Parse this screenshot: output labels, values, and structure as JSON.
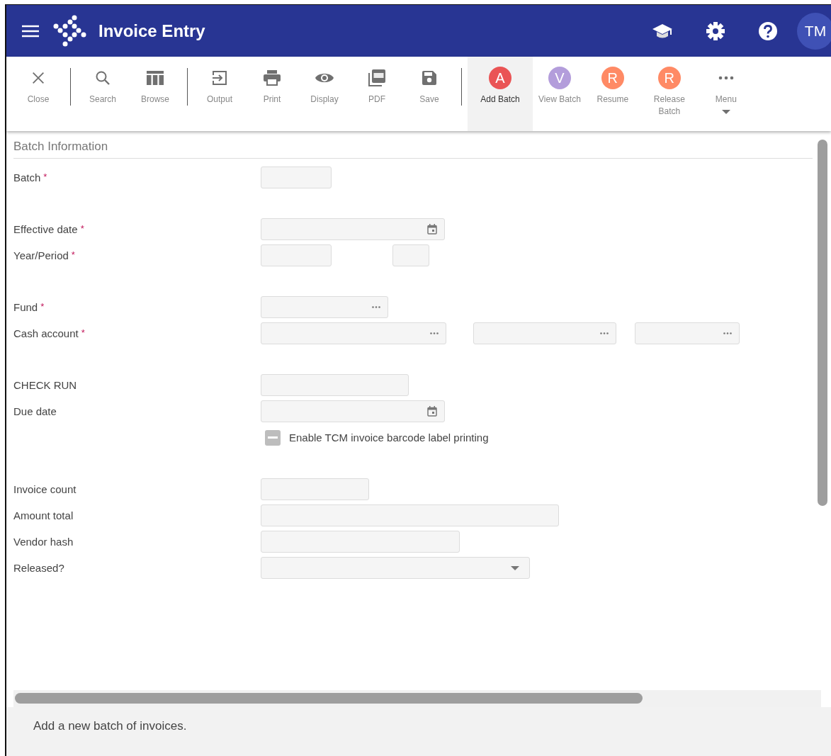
{
  "header": {
    "title": "Invoice Entry",
    "avatar": "TM"
  },
  "toolbar": [
    [
      {
        "kind": "close",
        "label": "Close",
        "selected": false
      }
    ],
    [
      {
        "kind": "search",
        "label": "Search",
        "selected": false
      },
      {
        "kind": "browse",
        "label": "Browse",
        "selected": false
      }
    ],
    [
      {
        "kind": "output",
        "label": "Output",
        "selected": false
      },
      {
        "kind": "print",
        "label": "Print",
        "selected": false
      },
      {
        "kind": "display",
        "label": "Display",
        "selected": false
      },
      {
        "kind": "pdf",
        "label": "PDF",
        "selected": false
      },
      {
        "kind": "save",
        "label": "Save",
        "selected": false
      }
    ],
    [
      {
        "kind": "letter",
        "letter": "A",
        "color": "#ea5455",
        "label": "Add Batch",
        "selected": true
      },
      {
        "kind": "letter",
        "letter": "V",
        "color": "#b39ddb",
        "label": "View Batch",
        "selected": false
      },
      {
        "kind": "letter",
        "letter": "R",
        "color": "#ff8a65",
        "label": "Resume",
        "selected": false
      },
      {
        "kind": "letter",
        "letter": "R",
        "color": "#ff8a65",
        "label": "Release Batch",
        "selected": false
      },
      {
        "kind": "more",
        "label": "Menu",
        "selected": false
      }
    ]
  ],
  "form": {
    "title": "Batch Information",
    "groups": [
      [
        {
          "kind": "field",
          "label": "Batch",
          "mark": "*",
          "inputs": [
            {
              "kind": "text"
            }
          ]
        }
      ],
      [
        {
          "kind": "field",
          "label": "Effective date",
          "mark": "*",
          "inputs": [
            {
              "kind": "date"
            }
          ]
        },
        {
          "kind": "field",
          "label": "Year/Period",
          "mark": "*",
          "inputs": [
            {
              "kind": "text"
            },
            {
              "kind": "text"
            }
          ]
        }
      ],
      [
        {
          "kind": "field",
          "label": "Fund",
          "mark": "*",
          "inputs": [
            {
              "kind": "lookup"
            }
          ]
        },
        {
          "kind": "field",
          "label": "Cash account",
          "mark": "*",
          "inputs": [
            {
              "kind": "lookup"
            },
            {
              "kind": "lookup"
            },
            {
              "kind": "lookup"
            }
          ]
        }
      ],
      [
        {
          "kind": "field",
          "label": "CHECK RUN",
          "inputs": [
            {
              "kind": "text"
            }
          ]
        },
        {
          "kind": "field",
          "label": "Due date",
          "inputs": [
            {
              "kind": "date"
            }
          ]
        },
        {
          "kind": "checkbox",
          "label": "Enable TCM invoice barcode label printing",
          "indeterminate": true
        }
      ],
      [
        {
          "kind": "field",
          "label": "Invoice count",
          "inputs": [
            {
              "kind": "text"
            }
          ]
        },
        {
          "kind": "field",
          "label": "Amount total",
          "inputs": [
            {
              "kind": "text"
            }
          ]
        },
        {
          "kind": "field",
          "label": "Vendor hash",
          "inputs": [
            {
              "kind": "text"
            }
          ]
        },
        {
          "kind": "field",
          "label": "Released?",
          "inputs": [
            {
              "kind": "select"
            }
          ]
        }
      ]
    ]
  },
  "status_bar": "Add a new batch of invoices."
}
